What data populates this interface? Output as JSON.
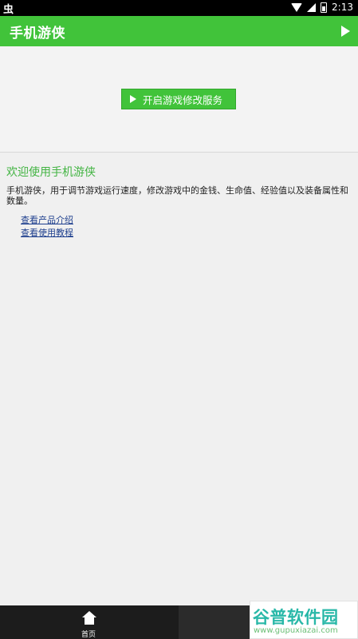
{
  "status_bar": {
    "left_icon": "bug",
    "right_time": "2:13",
    "icons": [
      "wifi-icon",
      "signal-icon",
      "battery-icon"
    ]
  },
  "app_bar": {
    "title": "手机游侠",
    "action_icon": "play-icon"
  },
  "top_area": {
    "start_button_label": "开启游戏修改服务"
  },
  "content": {
    "welcome": "欢迎使用手机游侠",
    "description": "手机游侠，用于调节游戏运行速度，修改游戏中的金钱、生命值、经验值以及装备属性和数量。",
    "links": [
      "查看产品介绍",
      "查看使用教程"
    ]
  },
  "bottom_nav": {
    "home_label": "首页",
    "home_icon": "home-icon"
  },
  "watermark": {
    "brand": "谷普软件园",
    "url": "www.gupuxiazai.com"
  },
  "colors": {
    "accent": "#41c33a",
    "link": "#1d3e8d",
    "status_bg": "#000000",
    "bottom_bg": "#2a2a2a"
  }
}
